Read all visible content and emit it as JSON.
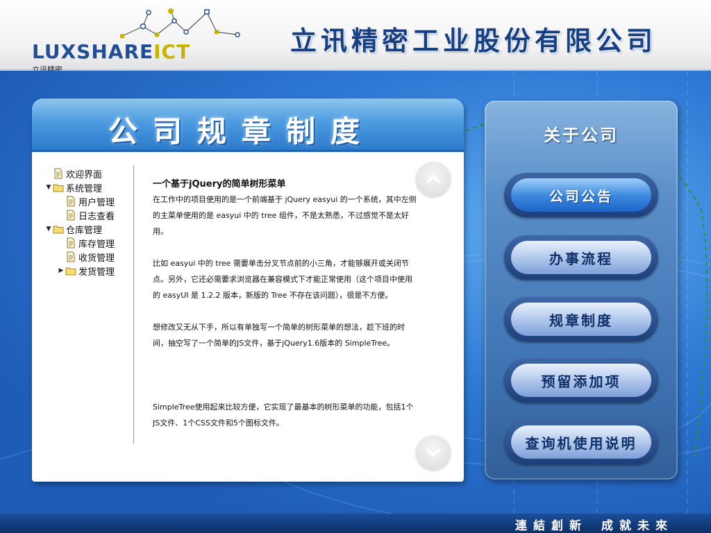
{
  "header": {
    "logo_main": "LUXSHARE",
    "logo_accent": "ICT",
    "logo_sub": "立讯精密",
    "company_name": "立讯精密工业股份有限公司"
  },
  "panel": {
    "title": "公司规章制度",
    "tree": [
      {
        "label": "欢迎界面",
        "level": 0,
        "type": "file"
      },
      {
        "label": "系统管理",
        "level": 0,
        "type": "folder",
        "state": "expanded"
      },
      {
        "label": "用户管理",
        "level": 1,
        "type": "file"
      },
      {
        "label": "日志查看",
        "level": 1,
        "type": "file"
      },
      {
        "label": "仓库管理",
        "level": 0,
        "type": "folder",
        "state": "expanded"
      },
      {
        "label": "库存管理",
        "level": 1,
        "type": "file"
      },
      {
        "label": "收货管理",
        "level": 1,
        "type": "file"
      },
      {
        "label": "发货管理",
        "level": 1,
        "type": "folder",
        "state": "collapsed"
      }
    ],
    "content": {
      "heading": "一个基于jQuery的简单树形菜单",
      "paragraphs": [
        "在工作中的项目使用的是一个前端基于 jQuery easyui 的一个系统，其中左侧的主菜单使用的是 easyui 中的 tree 组件，不是太熟悉，不过感觉不是太好用。",
        "比如 easyui 中的 tree 需要单击分叉节点前的小三角，才能够展开或关闭节点。另外，它还必需要求浏览器在兼容模式下才能正常使用（这个项目中使用的 easyUI 是 1.2.2 版本，新版的 Tree 不存在该问题），很是不方便。",
        "想修改又无从下手，所以有单独写一个简单的树形菜单的想法，趁下班的时间，抽空写了一个简单的JS文件，基于jQuery1.6版本的 SimpleTree。",
        "SimpleTree使用起来比较方便，它实现了最基本的树形菜单的功能，包括1个JS文件、1个CSS文件和5个图标文件。"
      ]
    }
  },
  "nav": {
    "title": "关于公司",
    "items": [
      {
        "label": "公司公告",
        "active": true
      },
      {
        "label": "办事流程",
        "active": false
      },
      {
        "label": "规章制度",
        "active": false
      },
      {
        "label": "预留添加项",
        "active": false
      },
      {
        "label": "查询机使用说明",
        "active": false
      }
    ]
  },
  "footer": {
    "slogan_left": "連結創新",
    "slogan_right": "成就未來"
  },
  "colors": {
    "brand_blue": "#1f4e97",
    "accent_yellow": "#c7b300",
    "title_blue": "#163e84",
    "active_button": "#1e64c8"
  },
  "icons": {
    "file": "document-icon",
    "folder": "folder-icon",
    "expanded": "triangle-down-icon",
    "collapsed": "triangle-right-icon",
    "scroll_up": "chevron-up-icon",
    "scroll_down": "chevron-down-icon"
  }
}
